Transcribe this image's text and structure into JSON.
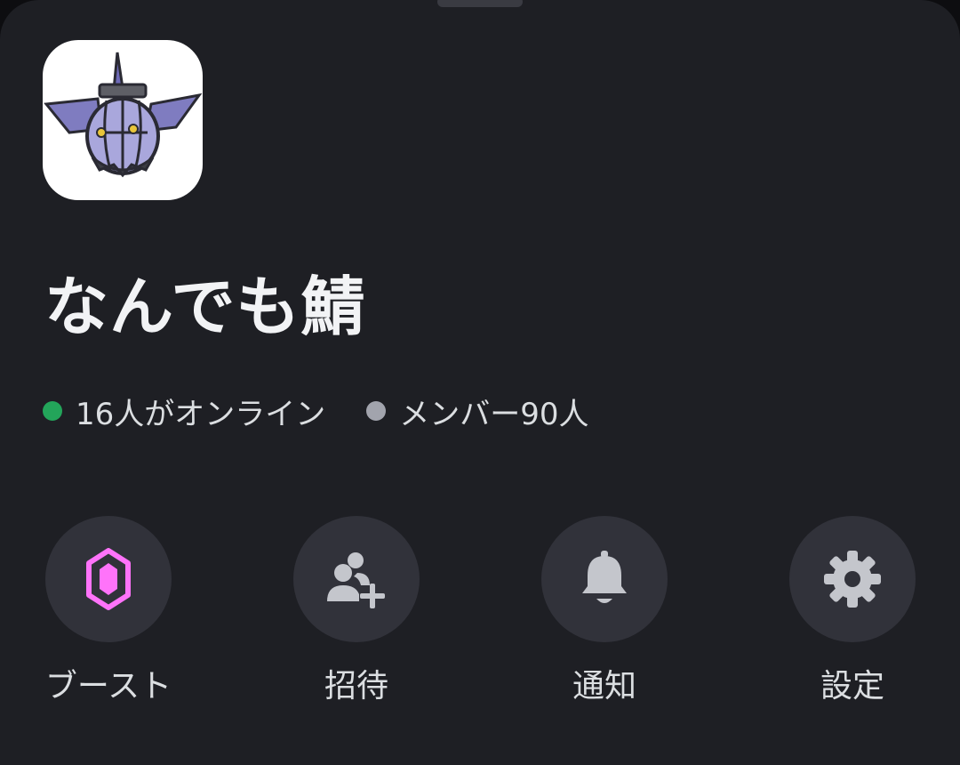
{
  "server": {
    "name": "なんでも鯖",
    "icon": "server-avatar-ghost-lantern"
  },
  "stats": {
    "online_text": "16人がオンライン",
    "members_text": "メンバー90人",
    "online_color": "#23a55a",
    "members_color": "#a2a4ad"
  },
  "actions": [
    {
      "label": "ブースト",
      "icon": "boost-gem-icon",
      "color": "#ff73fa"
    },
    {
      "label": "招待",
      "icon": "invite-person-plus-icon",
      "color": "#c4c6cc"
    },
    {
      "label": "通知",
      "icon": "bell-icon",
      "color": "#c4c6cc"
    },
    {
      "label": "設定",
      "icon": "gear-icon",
      "color": "#c4c6cc"
    }
  ]
}
